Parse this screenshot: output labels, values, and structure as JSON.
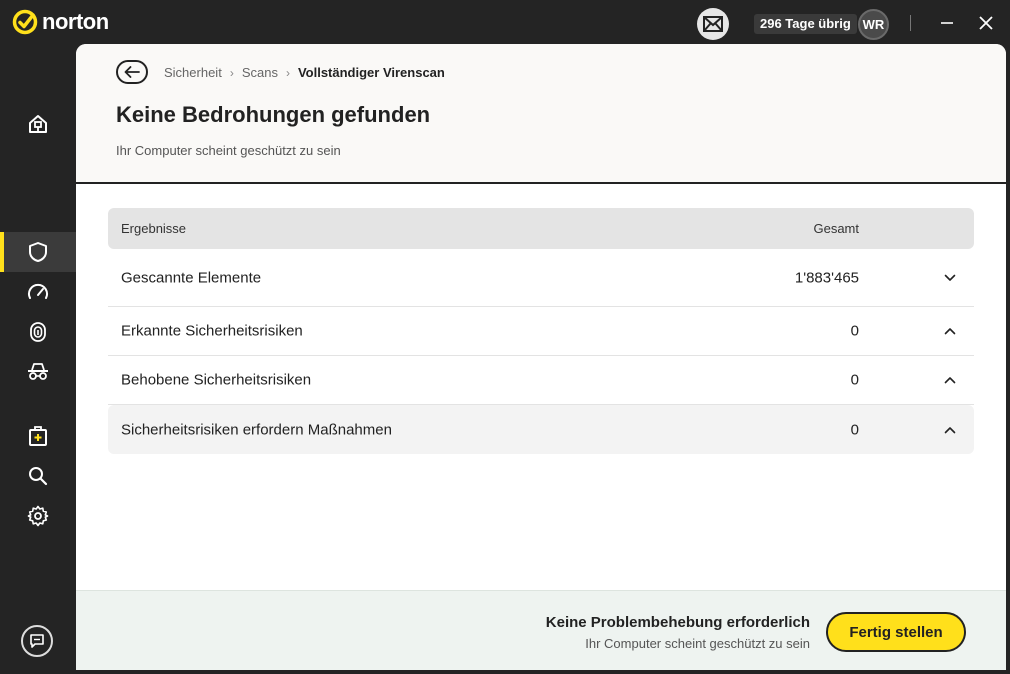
{
  "app": {
    "brand": "norton",
    "brand_color": "#ffe01b"
  },
  "titlebar": {
    "mail_icon": "envelope-icon",
    "days_left": "296 Tage übrig",
    "avatar_initials": "WR"
  },
  "sidebar": {
    "items": [
      {
        "icon": "home-icon"
      },
      {
        "icon": "shield-icon",
        "active": true
      },
      {
        "icon": "speedometer-icon"
      },
      {
        "icon": "fingerprint-icon"
      },
      {
        "icon": "incognito-icon"
      },
      {
        "icon": "medical-kit-icon"
      },
      {
        "icon": "search-icon"
      },
      {
        "icon": "gear-icon"
      }
    ],
    "chat_icon": "chat-icon"
  },
  "header": {
    "breadcrumb": [
      "Sicherheit",
      "Scans",
      "Vollständiger Virenscan"
    ],
    "title": "Keine Bedrohungen gefunden",
    "subtitle": "Ihr Computer scheint geschützt zu sein"
  },
  "results": {
    "columns": {
      "name": "Ergebnisse",
      "total": "Gesamt"
    },
    "rows": [
      {
        "name": "Gescannte Elemente",
        "value": "1'883'465",
        "expanded": false
      },
      {
        "name": "Erkannte Sicherheitsrisiken",
        "value": "0",
        "expanded": true
      },
      {
        "name": "Behobene Sicherheitsrisiken",
        "value": "0",
        "expanded": true
      },
      {
        "name": "Sicherheitsrisiken erfordern Maßnahmen",
        "value": "0",
        "expanded": true
      }
    ]
  },
  "footer": {
    "title": "Keine Problembehebung erforderlich",
    "subtitle": "Ihr Computer scheint geschützt zu sein",
    "button_label": "Fertig stellen"
  }
}
